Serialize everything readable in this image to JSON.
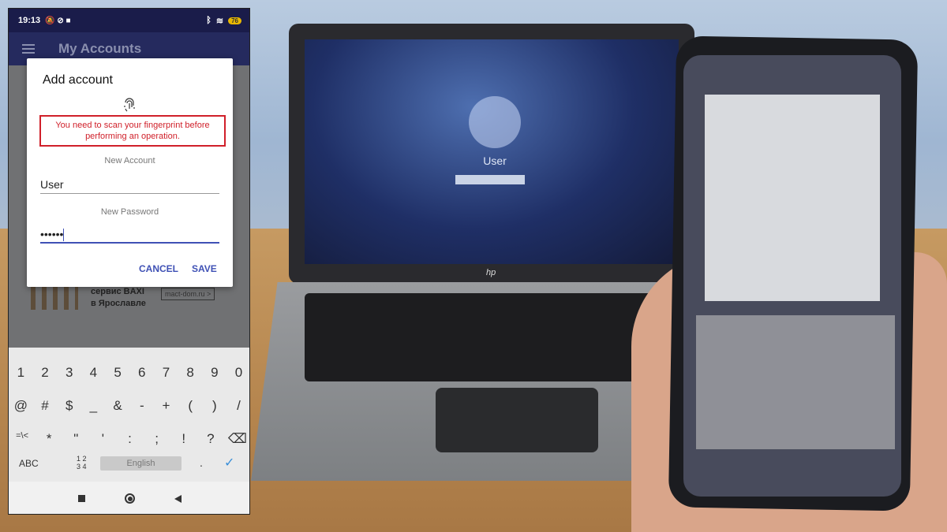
{
  "status_bar": {
    "time": "19:13",
    "battery": "76"
  },
  "app": {
    "title": "My Accounts"
  },
  "dialog": {
    "title": "Add account",
    "error": "You need to scan your fingerprint before performing an operation.",
    "account_label": "New Account",
    "account_value": "User",
    "password_label": "New Password",
    "password_value": "••••••",
    "cancel": "CANCEL",
    "save": "SAVE"
  },
  "ad": {
    "line1": "сервис BAXI",
    "line2": "в Ярославле",
    "link": "mact-dom.ru >"
  },
  "keyboard": {
    "row1": [
      "1",
      "2",
      "3",
      "4",
      "5",
      "6",
      "7",
      "8",
      "9",
      "0"
    ],
    "row2": [
      "@",
      "#",
      "$",
      "_",
      "&",
      "-",
      "+",
      "(",
      ")",
      "/"
    ],
    "row3": [
      "=\\<",
      "*",
      "\"",
      "'",
      ":",
      ";",
      "!",
      "?",
      "⌫"
    ],
    "abc": "ABC",
    "nums": "1 2 3 4",
    "space": "English",
    "dot": ".",
    "enter": "✓"
  },
  "photo": {
    "laptop_user": "User",
    "laptop_brand": "hp"
  }
}
